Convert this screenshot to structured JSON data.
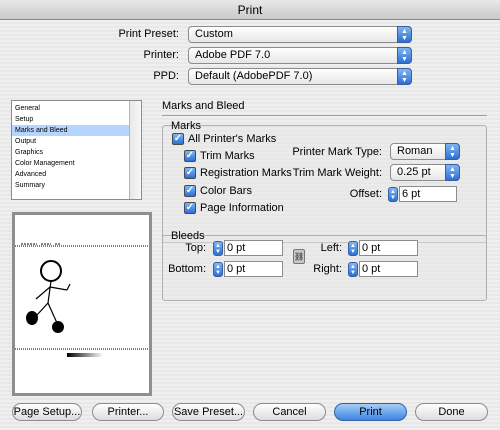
{
  "window": {
    "title": "Print"
  },
  "top": {
    "preset": {
      "label": "Print Preset:",
      "value": "Custom"
    },
    "printer": {
      "label": "Printer:",
      "value": "Adobe PDF 7.0"
    },
    "ppd": {
      "label": "PPD:",
      "value": "Default (AdobePDF 7.0)"
    }
  },
  "sidebar": {
    "items": [
      "General",
      "Setup",
      "Marks and Bleed",
      "Output",
      "Graphics",
      "Color Management",
      "Advanced",
      "Summary"
    ],
    "selected": "Marks and Bleed"
  },
  "panel": {
    "title": "Marks and Bleed",
    "marks": {
      "label": "Marks",
      "all": {
        "label": "All Printer's Marks",
        "checked": true
      },
      "trim": {
        "label": "Trim Marks",
        "checked": true
      },
      "registration": {
        "label": "Registration Marks",
        "checked": true
      },
      "colorbars": {
        "label": "Color Bars",
        "checked": true
      },
      "pageinfo": {
        "label": "Page Information",
        "checked": true
      },
      "type": {
        "label": "Printer Mark Type:",
        "value": "Roman"
      },
      "weight": {
        "label": "Trim Mark Weight:",
        "value": "0.25 pt"
      },
      "offset": {
        "label": "Offset:",
        "value": "6 pt"
      }
    },
    "bleeds": {
      "label": "Bleeds",
      "top": {
        "label": "Top:",
        "value": "0 pt"
      },
      "bottom": {
        "label": "Bottom:",
        "value": "0 pt"
      },
      "left": {
        "label": "Left:",
        "value": "0 pt"
      },
      "right": {
        "label": "Right:",
        "value": "0 pt"
      }
    }
  },
  "buttons": {
    "page_setup": "Page Setup...",
    "printer": "Printer...",
    "save_preset": "Save Preset...",
    "cancel": "Cancel",
    "print": "Print",
    "done": "Done"
  },
  "icons": {
    "check": "check-icon",
    "stepper": "stepper-icon",
    "chain": "chain-link-icon",
    "popup": "popup-arrows-icon"
  }
}
